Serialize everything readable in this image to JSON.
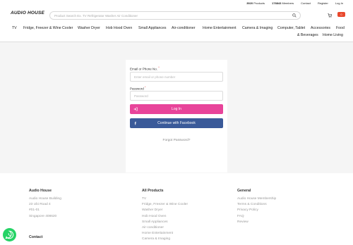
{
  "topbar": {
    "products_count": "3920",
    "products_label": "Products",
    "members_count": "178843",
    "members_label": "Members",
    "contact": "Contact",
    "register": "Register",
    "login": "Log In"
  },
  "header": {
    "logo": "AUDIO HOUSE",
    "search_placeholder": "Product Search Ex. TV Refrigerator Washer Air Conditioner",
    "cart_count": "0"
  },
  "nav": {
    "row1": [
      "TV",
      "Fridge, Freezer & Wine Cooler",
      "Washer Dryer",
      "Hob Hood Oven",
      "Small Appliances",
      "Air-conditioner",
      "Home Entertainment",
      "Camera & Imaging",
      "Computer, Tablet",
      "Accessories",
      "Food"
    ],
    "row2": [
      "& Beverages",
      "Home Living"
    ]
  },
  "login_form": {
    "email_label": "Email or Phone No.",
    "email_placeholder": "Enter email or phone number",
    "password_label": "Password",
    "password_placeholder": "Password",
    "required_mark": "*",
    "login_button": "Log In",
    "facebook_button": "Continue with Facebook",
    "forgot_link": "Forgot Password?"
  },
  "footer": {
    "col1": {
      "title": "Audio House",
      "items": [
        "Audio House Building",
        "23 Ubi Road 4",
        "#01-01",
        "Singapore 408620"
      ]
    },
    "col2": {
      "title": "All Products",
      "items": [
        "TV",
        "Fridge, Freezer & Wine Cooler",
        "Washer Dryer",
        "Hob Hood Oven",
        "Small Appliances",
        "Air-conditioner",
        "Home Entertainment",
        "Camera & Imaging"
      ]
    },
    "col3": {
      "title": "General",
      "items": [
        "Audio House Membership",
        "Terms & Conditions",
        "Privacy Policy",
        "FAQ",
        "Review"
      ]
    },
    "contact_title": "Contact"
  },
  "colors": {
    "login_button": "#e8449a",
    "facebook_button": "#3a5a99",
    "cart_badge": "#e8482d",
    "whatsapp": "#25d366"
  },
  "icons": [
    "search-icon",
    "cart-icon",
    "login-icon",
    "facebook-icon",
    "whatsapp-icon"
  ]
}
